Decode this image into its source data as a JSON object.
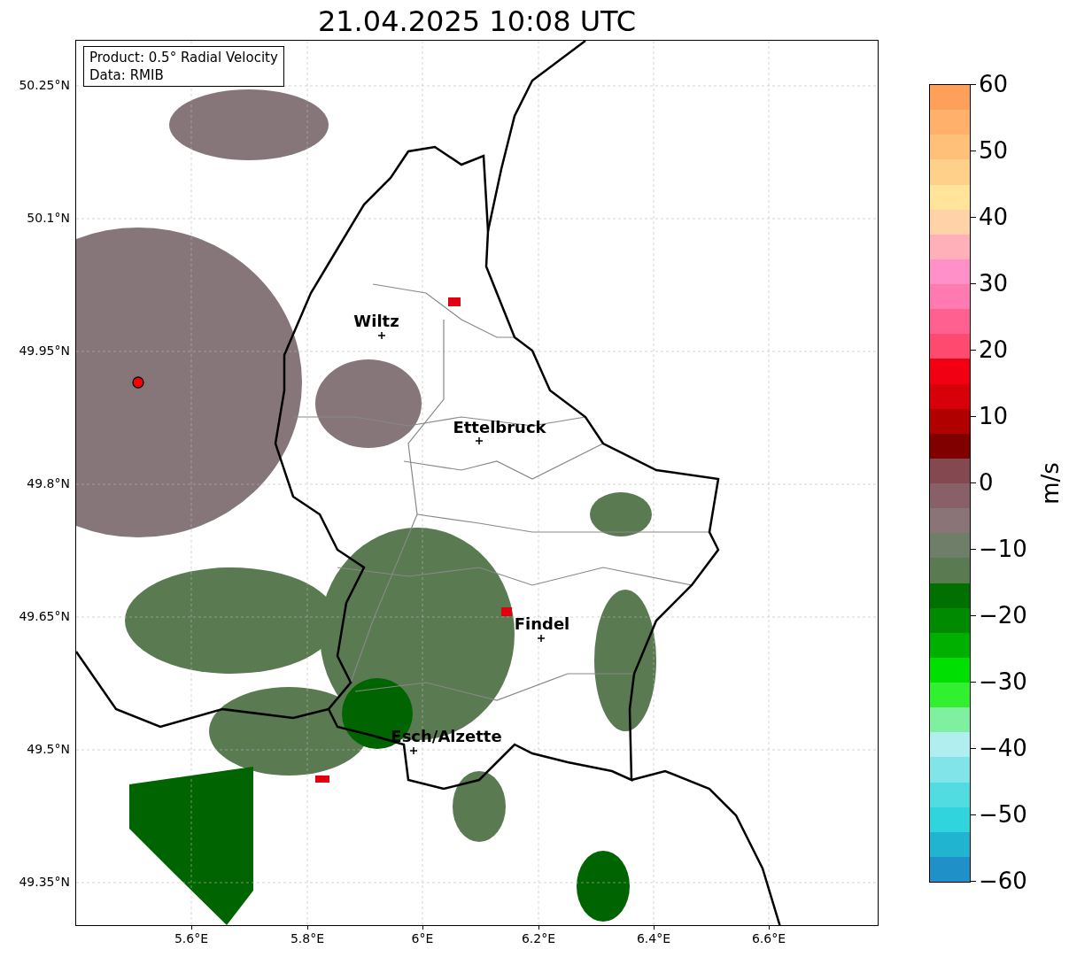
{
  "title": "21.04.2025 10:08 UTC",
  "info_box": [
    "Product: 0.5° Radial Velocity",
    "Data: RMIB"
  ],
  "cities": [
    {
      "name": "Wiltz"
    },
    {
      "name": "Ettelbruck"
    },
    {
      "name": "Findel"
    },
    {
      "name": "Esch/Alzette"
    }
  ],
  "y_ticks": [
    "50.25°N",
    "50.1°N",
    "49.95°N",
    "49.8°N",
    "49.65°N",
    "49.5°N",
    "49.35°N"
  ],
  "x_ticks": [
    "5.6°E",
    "5.8°E",
    "6°E",
    "6.2°E",
    "6.4°E",
    "6.6°E"
  ],
  "colorbar": {
    "label": "m/s",
    "ticks": [
      "60",
      "50",
      "40",
      "30",
      "20",
      "10",
      "0",
      "−10",
      "−20",
      "−30",
      "−40",
      "−50",
      "−60"
    ]
  }
}
